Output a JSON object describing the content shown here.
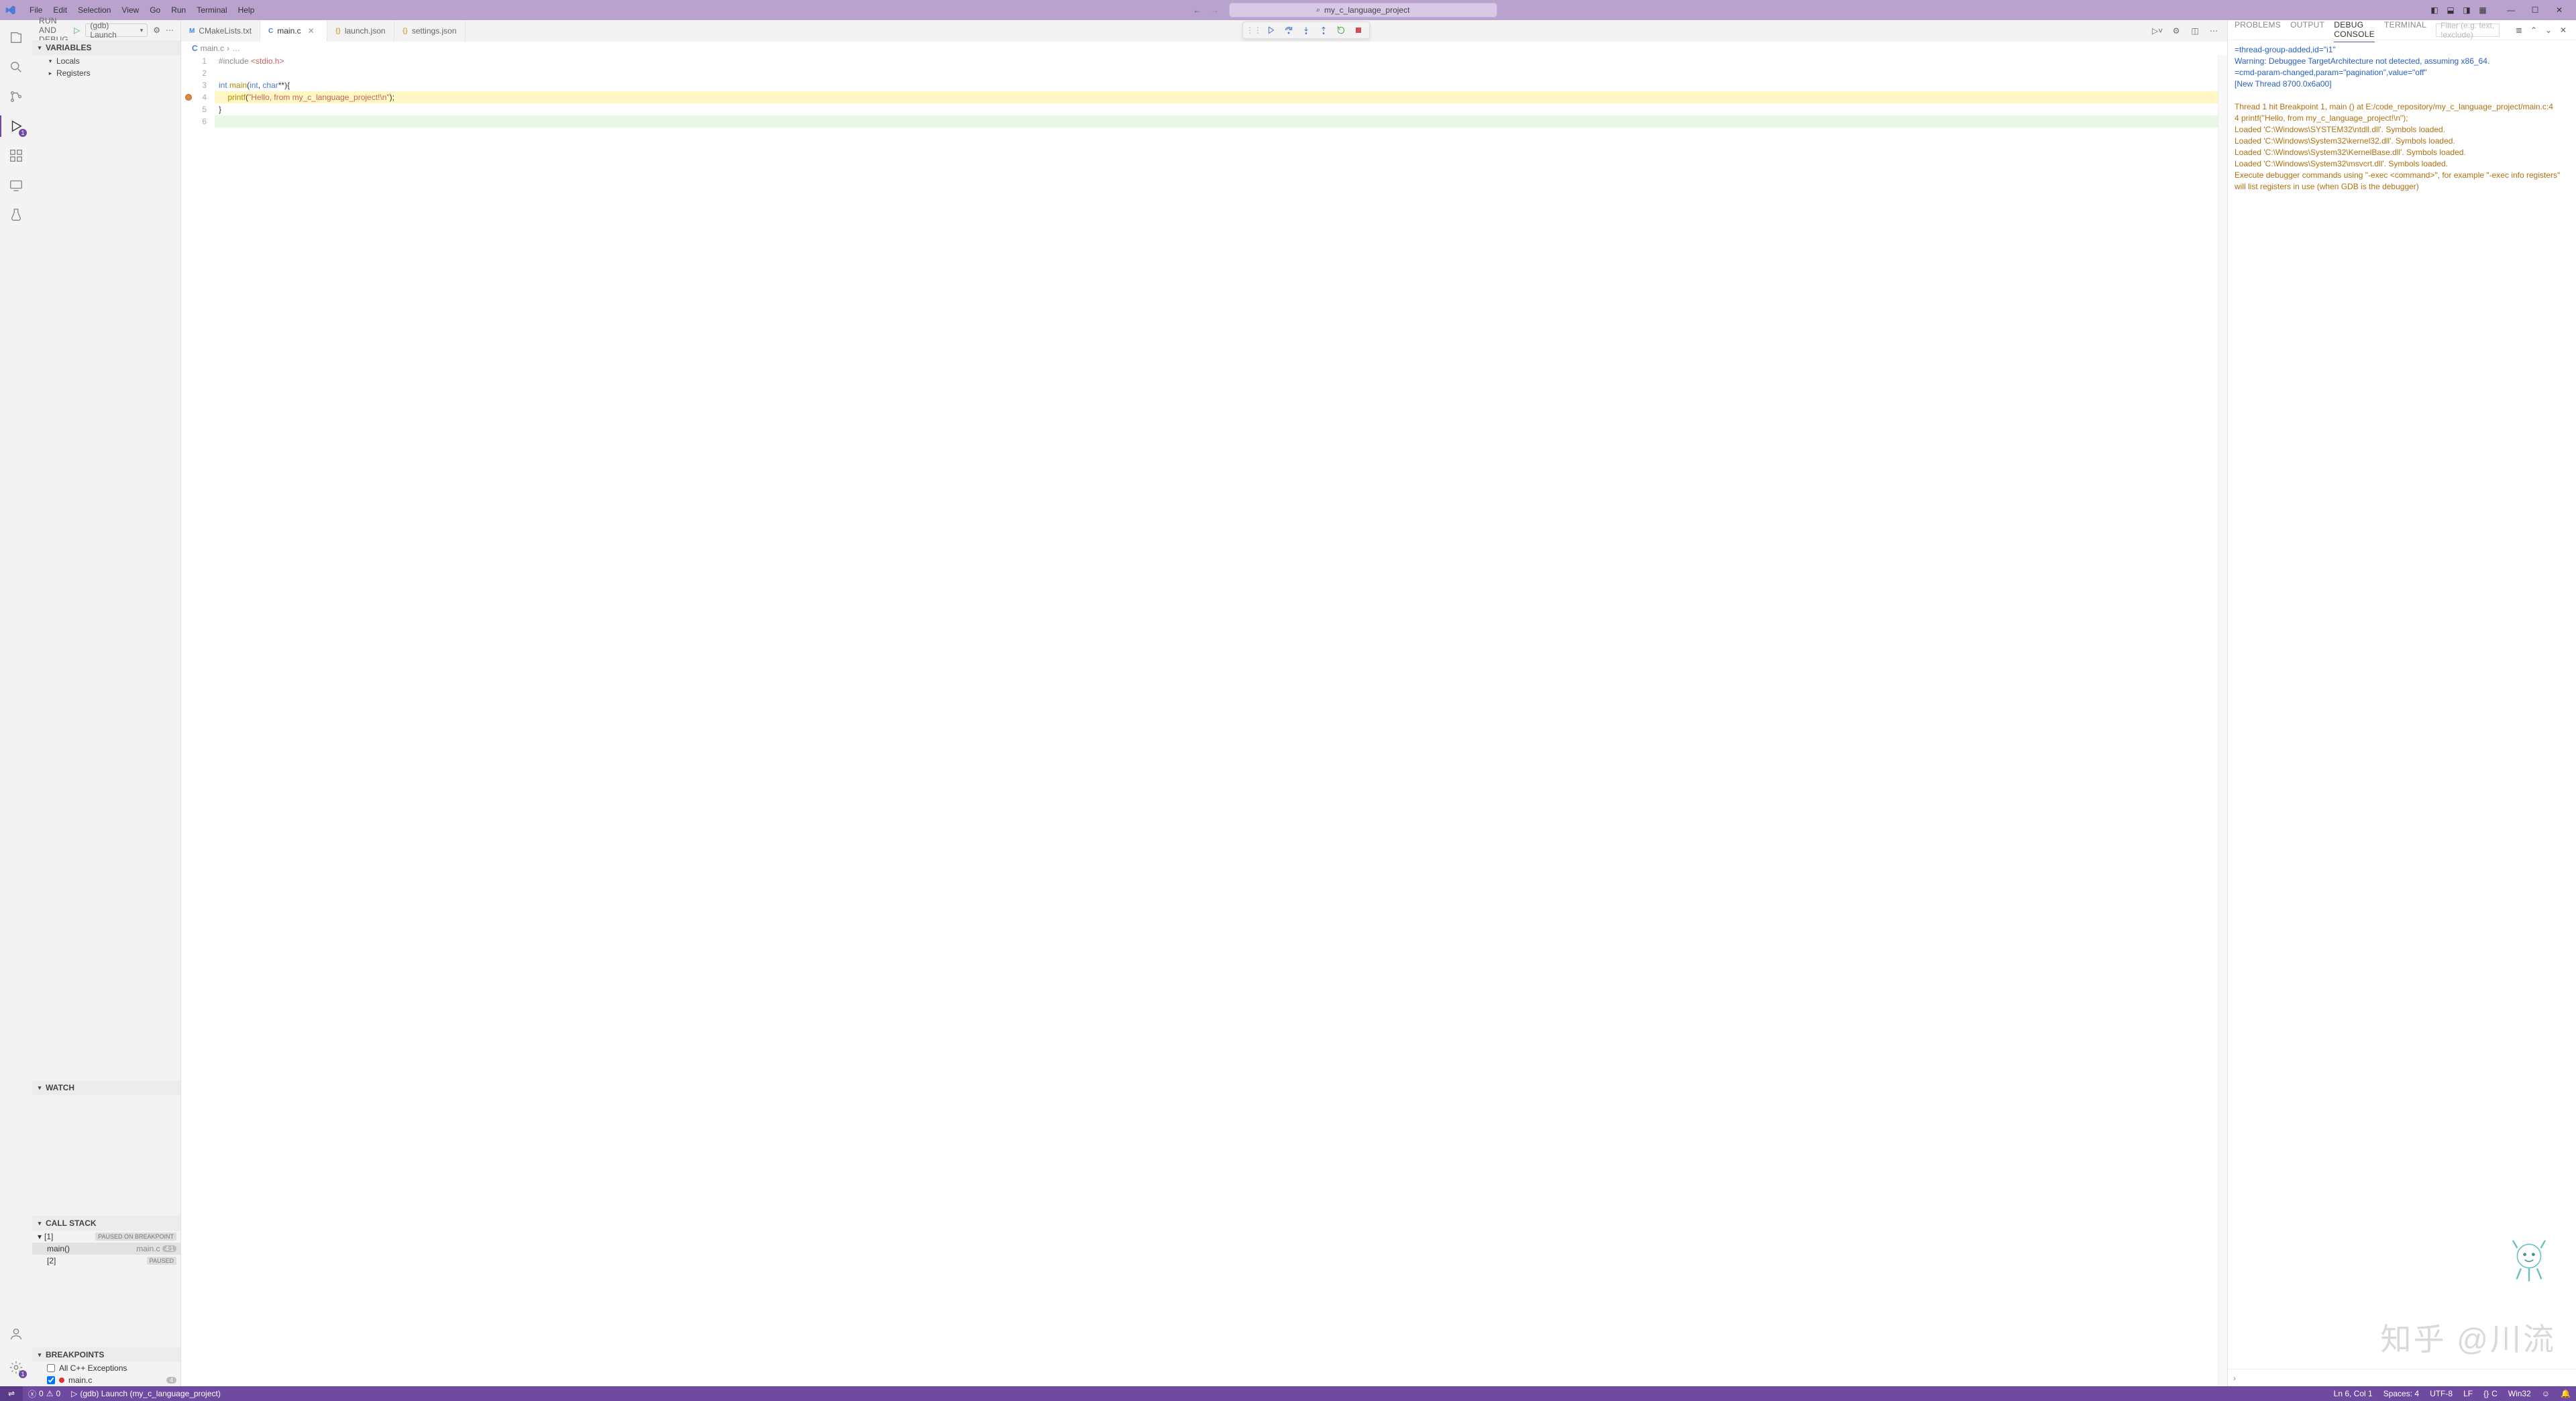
{
  "menu": [
    "File",
    "Edit",
    "Selection",
    "View",
    "Go",
    "Run",
    "Terminal",
    "Help"
  ],
  "search": {
    "text": "my_c_language_project"
  },
  "sidebar": {
    "title": "RUN AND DEBUG",
    "launch_label": "(gdb) Launch",
    "sections": {
      "variables": "VARIABLES",
      "watch": "WATCH",
      "callstack": "CALL STACK",
      "breakpoints": "BREAKPOINTS"
    },
    "var_nodes": [
      "Locals",
      "Registers"
    ],
    "call": [
      {
        "label": "[1]",
        "status": "PAUSED ON BREAKPOINT",
        "expanded": true
      },
      {
        "label": "main()",
        "file": "main.c",
        "badge": "4:1",
        "sel": true
      },
      {
        "label": "[2]",
        "status": "PAUSED"
      }
    ],
    "bp": [
      {
        "label": "All C++ Exceptions",
        "checked": false
      },
      {
        "label": "main.c",
        "checked": true,
        "badge": "4"
      }
    ]
  },
  "tabs": [
    {
      "label": "CMakeLists.txt",
      "icon": "M",
      "icolor": "#4285f4"
    },
    {
      "label": "main.c",
      "icon": "C",
      "icolor": "#4a7cd1",
      "active": true,
      "close": true
    },
    {
      "label": "launch.json",
      "icon": "{}",
      "icolor": "#d4a84a"
    },
    {
      "label": "settings.json",
      "icon": "{}",
      "icolor": "#d4a84a"
    }
  ],
  "breadcrumb": [
    "main.c",
    "…"
  ],
  "code": [
    {
      "n": 1,
      "html": "<span class='pre'>#include</span> <span class='str'>&lt;stdio.h&gt;</span>"
    },
    {
      "n": 2,
      "html": ""
    },
    {
      "n": 3,
      "html": "<span class='kw'>int</span> <span class='fn'>main</span>(<span class='kw'>int</span>, <span class='kw'>char</span>**){"
    },
    {
      "n": 4,
      "html": "    <span class='fn'>printf</span>(<span class='str'>\"Hello, from my_c_language_project!\\n\"</span>);",
      "hl": true
    },
    {
      "n": 5,
      "html": "}"
    },
    {
      "n": 6,
      "html": "",
      "hlg": true
    }
  ],
  "breakpoint_line": 4,
  "panel": {
    "tabs": [
      "PROBLEMS",
      "OUTPUT",
      "DEBUG CONSOLE",
      "TERMINAL"
    ],
    "active": "DEBUG CONSOLE",
    "filter_placeholder": "Filter (e.g. text, !exclude)",
    "lines": [
      {
        "c": "blue",
        "t": "=thread-group-added,id=\"i1\""
      },
      {
        "c": "blue",
        "t": "Warning: Debuggee TargetArchitecture not detected, assuming x86_64."
      },
      {
        "c": "blue",
        "t": "=cmd-param-changed,param=\"pagination\",value=\"off\""
      },
      {
        "c": "blue",
        "t": "[New Thread 8700.0x6a00]"
      },
      {
        "c": "",
        "t": ""
      },
      {
        "c": "orange",
        "t": "Thread 1 hit Breakpoint 1, main () at E:/code_repository/my_c_language_project/main.c:4"
      },
      {
        "c": "orange",
        "t": "4           printf(\"Hello, from my_c_language_project!\\n\");"
      },
      {
        "c": "orange",
        "t": "Loaded 'C:\\Windows\\SYSTEM32\\ntdll.dll'. Symbols loaded."
      },
      {
        "c": "orange",
        "t": "Loaded 'C:\\Windows\\System32\\kernel32.dll'. Symbols loaded."
      },
      {
        "c": "orange",
        "t": "Loaded 'C:\\Windows\\System32\\KernelBase.dll'. Symbols loaded."
      },
      {
        "c": "orange",
        "t": "Loaded 'C:\\Windows\\System32\\msvcrt.dll'. Symbols loaded."
      },
      {
        "c": "orange",
        "t": "Execute debugger commands using \"-exec <command>\", for example \"-exec info registers\" will list registers in use (when GDB is the debugger)"
      }
    ]
  },
  "status": {
    "remote": "⇌",
    "errors": "0",
    "warnings": "0",
    "launch": "(gdb) Launch (my_c_language_project)",
    "ln": "Ln 6, Col 1",
    "spaces": "Spaces: 4",
    "enc": "UTF-8",
    "eol": "LF",
    "lang": "C",
    "port": "Win32"
  },
  "watermark": "知乎  @川流"
}
